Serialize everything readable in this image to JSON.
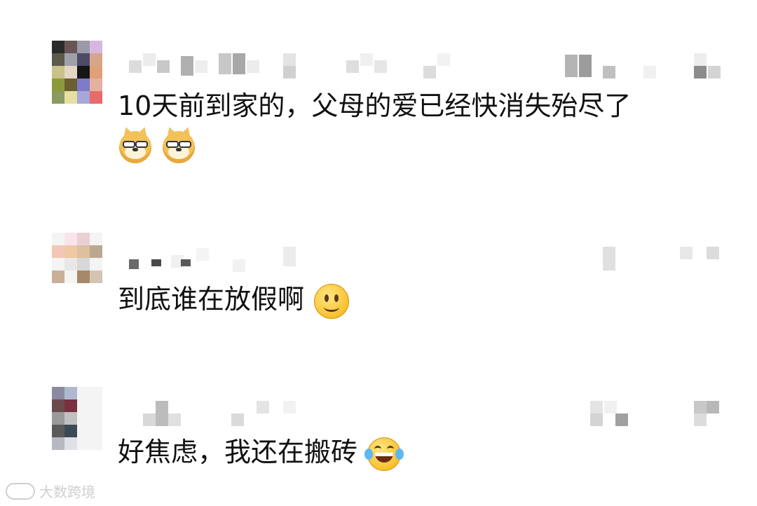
{
  "comments": [
    {
      "text": "10天前到家的，父母的爱已经快消失殆尽了",
      "emojis": [
        "doge-emoji",
        "doge-emoji"
      ],
      "avatar_colors": [
        "#2b2b2b",
        "#6a5555",
        "#9a9aa8",
        "#d7b7e0",
        "#5c5a48",
        "#a0a0a8",
        "#4c4a66",
        "#d6a58a",
        "#c9c28a",
        "#e4d6c4",
        "#151515",
        "#e0a07a",
        "#8e9a3a",
        "#6a6030",
        "#7e7ac8",
        "#e4b0a0",
        "#8a9a60",
        "#e6e0a0",
        "#a6a8d8",
        "#e86a6a"
      ]
    },
    {
      "text": "到底谁在放假啊",
      "emojis": [
        "smile-emoji"
      ],
      "avatar_colors": [
        "#f4f4f4",
        "#f8e4ec",
        "#e8d0d4",
        "#f4f4f4",
        "#f2c8b4",
        "#f0c8a6",
        "#dcc0a0",
        "#bba890",
        "#f4f4f4",
        "#e8e8e8",
        "#d8d8d8",
        "#f4f4f4",
        "#c8b098",
        "#f4f4f4",
        "#a88868",
        "#d4c4b4"
      ]
    },
    {
      "text": "好焦虑，我还在搬砖",
      "emojis": [
        "laugh-emoji"
      ],
      "avatar_colors": [
        "#8a8aa0",
        "#b0b8d0",
        "#f4f4f4",
        "#f4f4f4",
        "#6a4a4a",
        "#7a3040",
        "#f4f4f4",
        "#f4f4f4",
        "#9a9a9a",
        "#c0c0c0",
        "#f4f4f4",
        "#f4f4f4",
        "#5a5a5a",
        "#3c4a58",
        "#f4f4f4",
        "#f4f4f4",
        "#b8b8c0",
        "#e0e0e8",
        "#f4f4f4",
        "#f4f4f4"
      ]
    }
  ],
  "watermark": {
    "text": "大数跨境"
  }
}
